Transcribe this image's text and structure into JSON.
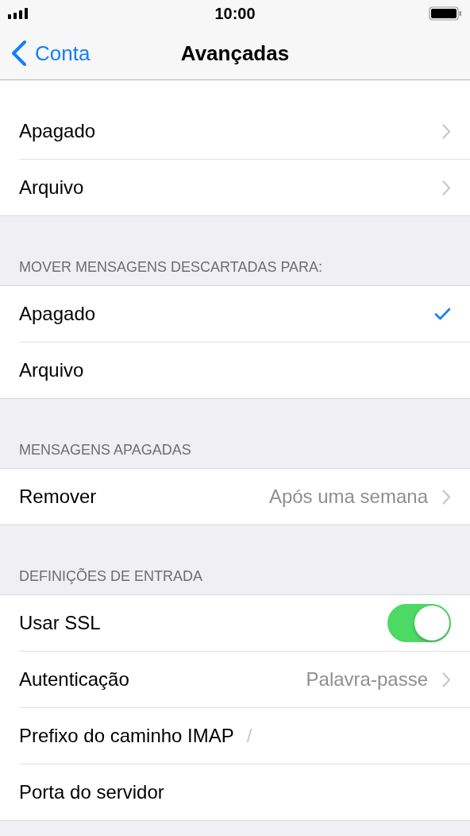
{
  "status_bar": {
    "time": "10:00"
  },
  "nav_bar": {
    "back": "Conta",
    "title": "Avançadas"
  },
  "sections": [
    {
      "rows": [
        {
          "kind": "nav",
          "label": "Apagado"
        },
        {
          "kind": "nav",
          "label": "Arquivo"
        }
      ]
    },
    {
      "header": "MOVER MENSAGENS DESCARTADAS PARA:",
      "rows": [
        {
          "kind": "check",
          "label": "Apagado",
          "selected": true
        },
        {
          "kind": "check",
          "label": "Arquivo",
          "selected": false
        }
      ]
    },
    {
      "header": "MENSAGENS APAGADAS",
      "rows": [
        {
          "kind": "nav",
          "label": "Remover",
          "value": "Após uma semana"
        }
      ]
    },
    {
      "header": "DEFINIÇÕES DE ENTRADA",
      "rows": [
        {
          "kind": "toggle",
          "label": "Usar SSL",
          "on": true
        },
        {
          "kind": "nav",
          "label": "Autenticação",
          "value": "Palavra-passe"
        },
        {
          "kind": "field",
          "label": "Prefixo do caminho IMAP",
          "placeholder": "/"
        },
        {
          "kind": "field",
          "label": "Porta do servidor"
        }
      ]
    }
  ]
}
